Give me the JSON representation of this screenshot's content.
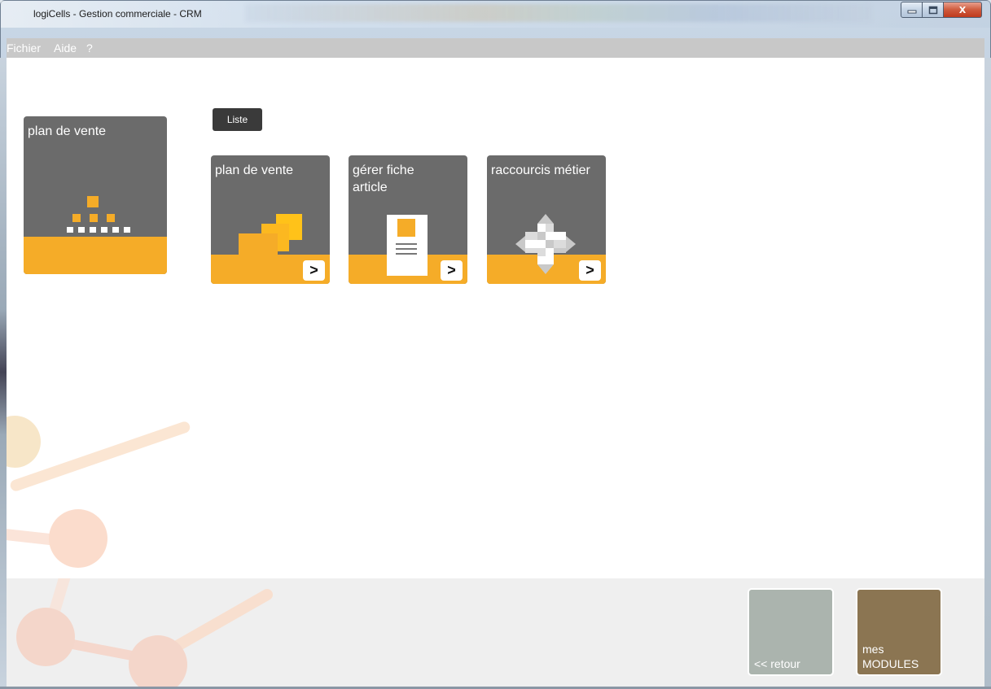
{
  "window": {
    "title": "logiCells - Gestion commerciale - CRM",
    "controls": {
      "minimize": "–",
      "maximize": "□",
      "close": "X"
    }
  },
  "menu": {
    "items": [
      {
        "label": "Fichier"
      },
      {
        "label": "Aide"
      },
      {
        "label": "?"
      }
    ]
  },
  "main": {
    "module_tile": {
      "title": "plan de vente",
      "icon": "pyramid-icon"
    },
    "view_button": {
      "label": "Liste"
    },
    "tiles": [
      {
        "title": "plan de vente",
        "icon": "stacked-squares-icon",
        "arrow": ">"
      },
      {
        "title": "gérer fiche article",
        "icon": "document-icon",
        "arrow": ">"
      },
      {
        "title": "raccourcis métier",
        "icon": "move-arrows-icon",
        "arrow": ">"
      }
    ]
  },
  "footer": {
    "retour": {
      "label": "<< retour"
    },
    "modules": {
      "line1": "mes",
      "line2": "MODULES"
    }
  },
  "colors": {
    "tile_gray": "#6b6b6b",
    "tile_orange": "#f5ac28",
    "menubar": "#c8c8c8",
    "retour_bg": "#abb4ae",
    "modules_bg": "#8b7552",
    "liste_bg": "#3a3a3a"
  }
}
